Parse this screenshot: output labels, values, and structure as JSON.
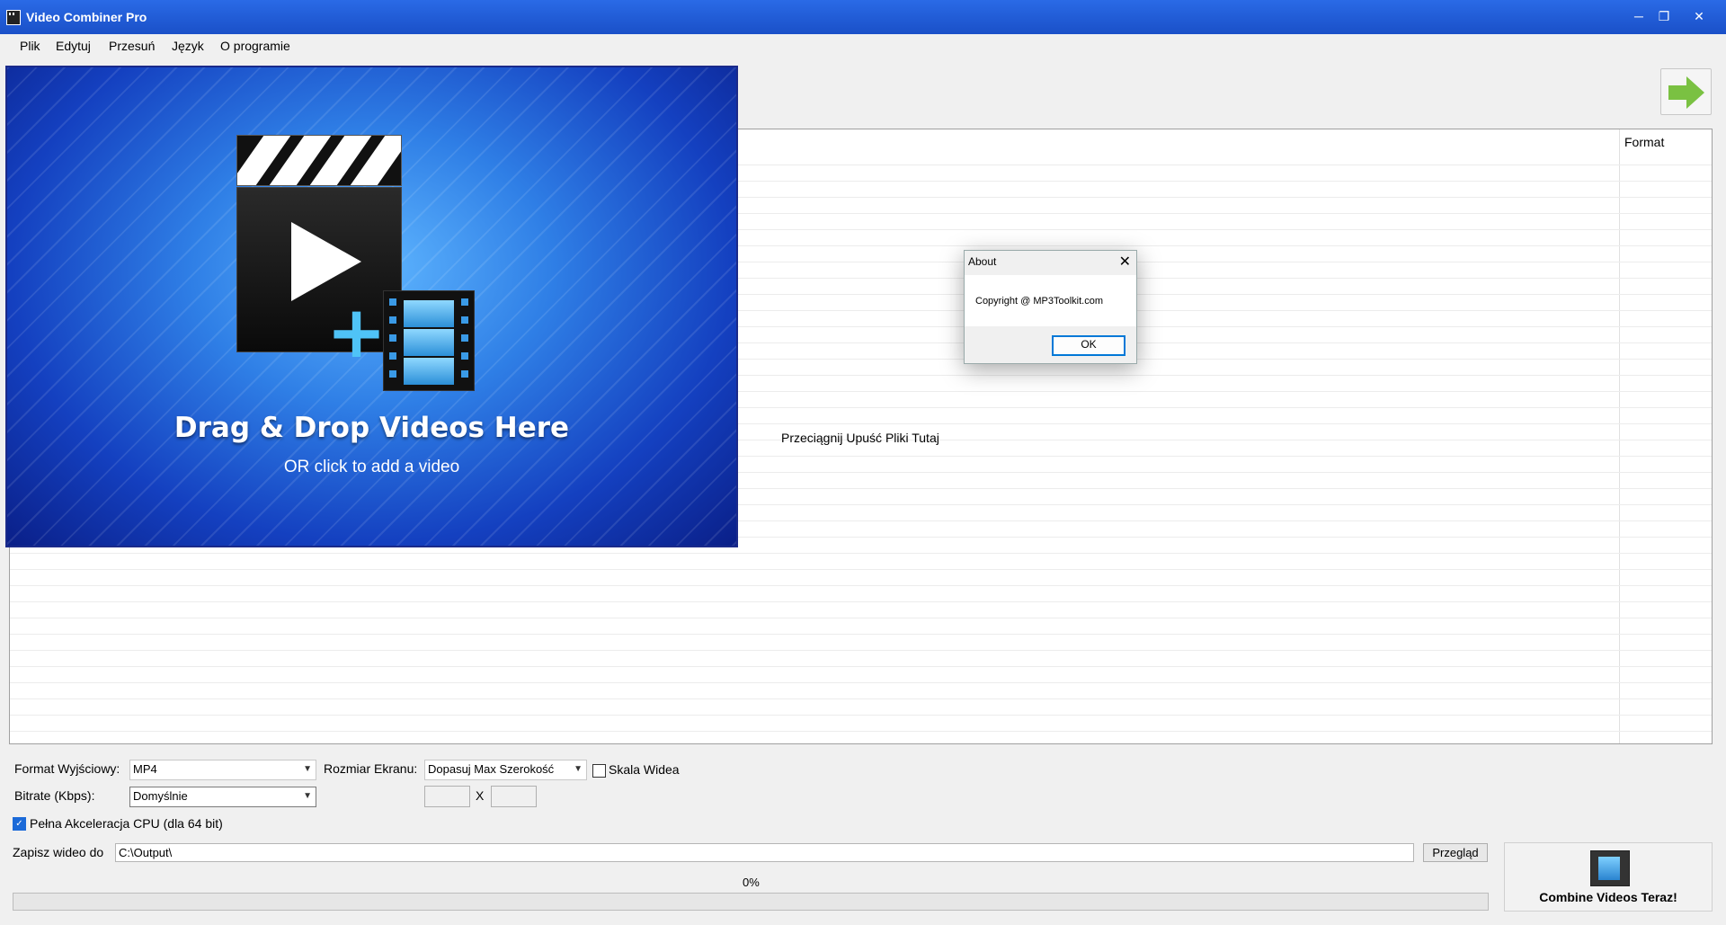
{
  "window": {
    "title": "Video Combiner Pro",
    "minimize": "─",
    "maximize": "❐",
    "close": "✕"
  },
  "menu": [
    "Plik",
    "Edytuj",
    "Przesuń",
    "Język",
    "O programie"
  ],
  "list": {
    "column_format": "Format",
    "drop_hint": "Przeciągnij  Upuść Pliki Tutaj"
  },
  "drop_panel": {
    "title": "Drag & Drop Videos Here",
    "subtitle": "OR click to add a video"
  },
  "about_dialog": {
    "title": "About",
    "message": "Copyright @ MP3Toolkit.com",
    "ok_label": "OK",
    "close_glyph": "✕"
  },
  "settings": {
    "format_label": "Format Wyjściowy:",
    "format_value": "MP4",
    "screen_size_label": "Rozmiar Ekranu:",
    "screen_size_value": "Dopasuj Max Szerokość",
    "scale_label": "Skala Widea",
    "scale_checked": false,
    "bitrate_label": "Bitrate (Kbps):",
    "bitrate_value": "Domyślnie",
    "size_separator": "X",
    "cpu_label": "Pełna Akceleracja CPU (dla 64 bit)",
    "cpu_checked": true
  },
  "output": {
    "label": "Zapisz wideo do",
    "path": "C:\\Output\\",
    "browse_label": "Przegląd"
  },
  "progress": {
    "text": "0%",
    "value": 0
  },
  "combine_button": {
    "label": "Combine Videos Teraz!"
  },
  "colors": {
    "titlebar": "#1a50c8",
    "accent": "#0078d7",
    "arrow": "#7ac142"
  }
}
